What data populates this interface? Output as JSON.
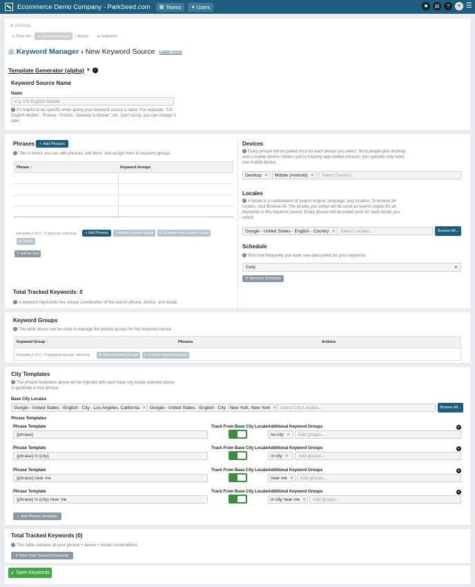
{
  "topbar": {
    "company": "Ecommerce Demo Company - ParkSeed.com",
    "teams": "Teams",
    "users": "Users"
  },
  "settings": {
    "label": "Settings",
    "tabs": [
      "Team info",
      "Keyword Manager",
      "Brands",
      "Segments"
    ]
  },
  "page": {
    "title_prefix": "Keyword Manager",
    "title_sep": "›",
    "title": "New Keyword Source",
    "learn_more": "Learn more",
    "template_generator": "Template Generator (alpha)"
  },
  "source": {
    "heading": "Keyword Source Name",
    "name_label": "Name",
    "name_placeholder": "e.g. US English Mobile",
    "help_1": "It's helpful to be specific when giving your keyword source a name. For example, \"US",
    "help_2": "English Mobile\", \"France - French - Desktop & Mobile\", etc. Don't worry, you can change it",
    "help_3": "later."
  },
  "phrases": {
    "heading": "Phrases",
    "add_button": "Add Phrases",
    "help": "This is where you can add phrases, edit them, and assign them to keyword groups.",
    "col_phrase": "Phrase",
    "col_groups": "Keyword Groups",
    "showing": "Showing 0 of 0 - 0 phrases selected",
    "btn_add": "Add Phrases",
    "btn_add_group": "Add to Keyword Group",
    "btn_remove_group": "Remove from Keyword Group",
    "btn_delete": "Delete",
    "btn_edit_text": "Edit as Text"
  },
  "devices": {
    "heading": "Devices",
    "help_1": "Every phrase will be pulled once for each device you select. Most people pick desktop",
    "help_2": "and a mobile device. Unless you're tracking app-related phrases, you typically only need",
    "help_3": "one mobile device.",
    "selected": [
      "Desktop",
      "Mobile (Android)"
    ],
    "placeholder": "Select Devices..."
  },
  "locales": {
    "heading": "Locales",
    "help_1": "A locale is a combination of search engine, language, and location. To browse all",
    "help_2": "locales, click Browse All. The locales you select will be used as search origins for all",
    "help_3": "keywords in this keyword source. Every phrase will be pulled once for each locale you",
    "help_4": "select.",
    "selected": "Google - United States - English - Country",
    "placeholder": "Select Locales...",
    "browse": "Browse All..."
  },
  "schedule": {
    "heading": "Schedule",
    "help": "Pick how frequently you want new data pulled for your keywords.",
    "value": "Daily",
    "remove": "Remove Schedule"
  },
  "tracked": {
    "heading": "Total Tracked Keywords: 0",
    "help": "A keyword represents the unique combination of the search phrase, device, and locale."
  },
  "groups": {
    "heading": "Keyword Groups",
    "help": "The table above can be used to manage the phrase groups for this keyword source.",
    "col_group": "Keyword Group",
    "col_phrases": "Phrases",
    "col_actions": "Actions",
    "showing": "Showing 0 of 0 - 0 keyword groups selected",
    "btn_move": "Move Keyword Groups",
    "btn_remove": "Remove Keyword Groups"
  },
  "city": {
    "heading": "City Templates",
    "help_1": "The phrase templates above will be injected with each base city locale selected above",
    "help_2": "to generate a new phrase.",
    "base_label": "Base City Locales",
    "base_selected": [
      "Google - United States - English - City - Los Angeles, California",
      "Google - United States - English - City - New York, New York"
    ],
    "base_placeholder": "Select City Locales...",
    "browse": "Browse All...",
    "templates_label": "Phrase Templates",
    "col_template": "Phrase Template",
    "col_track": "Track From Base City Locale",
    "col_groups": "Additional Keyword Groups",
    "groups_placeholder": "Add groups...",
    "rows": [
      {
        "template": "{phrase}",
        "group": "no city"
      },
      {
        "template": "{phrase} in {city}",
        "group": "in city"
      },
      {
        "template": "{phrase} near me",
        "group": "near me"
      },
      {
        "template": "{phrase} in {city} near me",
        "group": "in city near me"
      }
    ],
    "add_template": "Add Phrase Template"
  },
  "total": {
    "heading": "Total Tracked Keywords (0)",
    "help": "This table contains all your phrase + device + locale combinations.",
    "view_button": "View Total Tracked Keywords"
  },
  "save": "Save Keywords"
}
